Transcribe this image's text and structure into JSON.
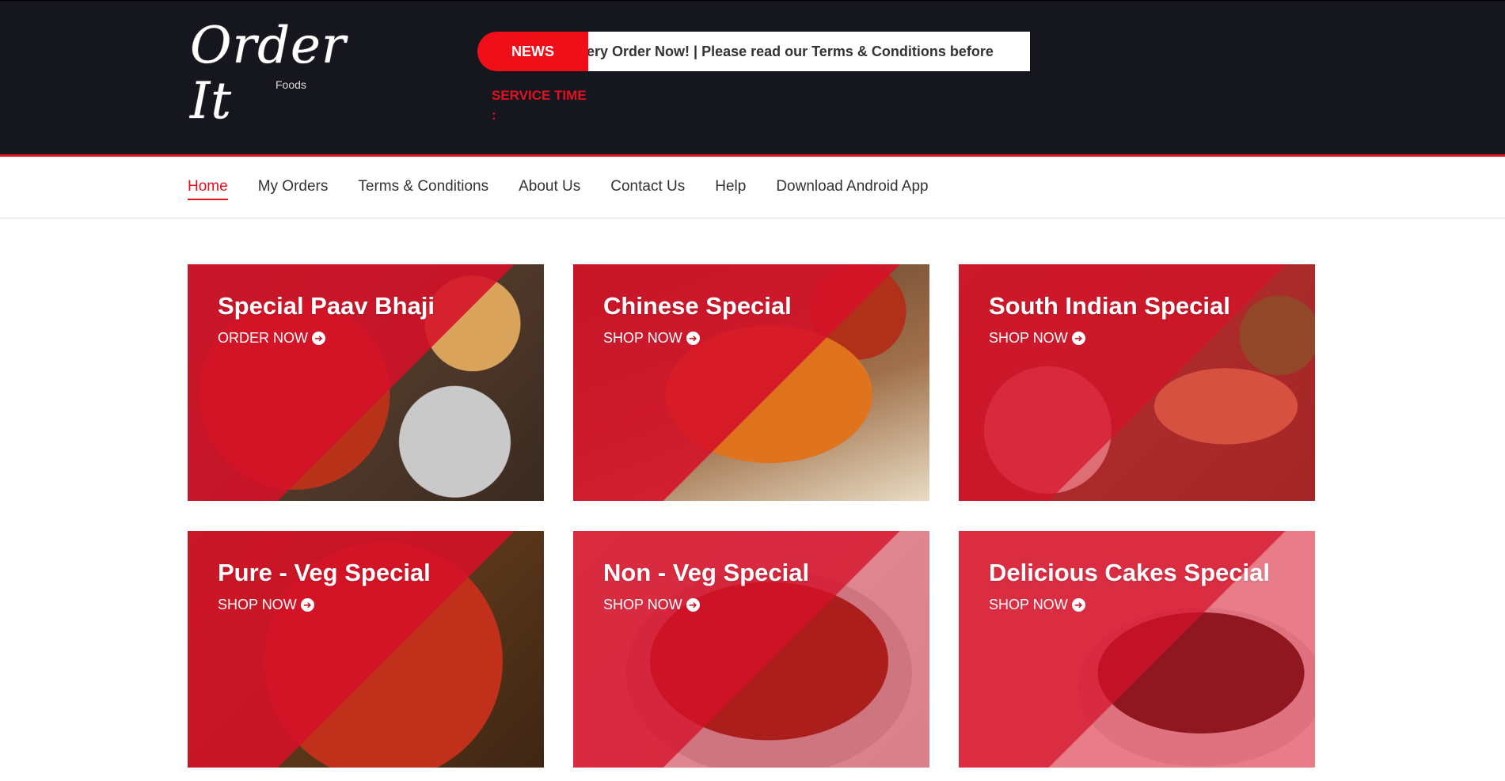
{
  "header": {
    "logo_text": "Order It",
    "logo_sub": "Foods",
    "news_label": "NEWS",
    "news_text": "very Order Now! | Please read our Terms & Conditions before",
    "service_label": "SERVICE TIME",
    "service_value": ":"
  },
  "nav": {
    "items": [
      {
        "label": "Home"
      },
      {
        "label": "My Orders"
      },
      {
        "label": "Terms & Conditions"
      },
      {
        "label": "About Us"
      },
      {
        "label": "Contact Us"
      },
      {
        "label": "Help"
      },
      {
        "label": "Download Android App"
      }
    ]
  },
  "tiles": [
    {
      "title": "Special Paav Bhaji",
      "cta": "ORDER NOW"
    },
    {
      "title": "Chinese Special",
      "cta": "SHOP NOW"
    },
    {
      "title": "South Indian Special",
      "cta": "SHOP NOW"
    },
    {
      "title": "Pure - Veg Special",
      "cta": "SHOP NOW"
    },
    {
      "title": "Non - Veg Special",
      "cta": "SHOP NOW"
    },
    {
      "title": "Delicious Cakes Special",
      "cta": "SHOP NOW"
    }
  ],
  "colors": {
    "accent": "#e0121f",
    "header_bg": "#15161e"
  },
  "icons": {
    "cta": "arrow-circle-right-icon"
  }
}
